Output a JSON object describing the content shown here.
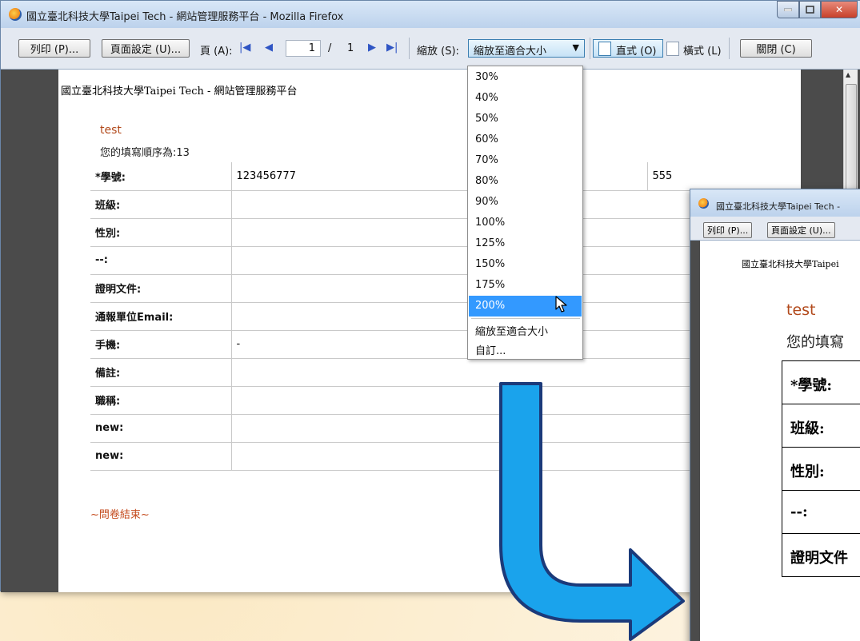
{
  "window": {
    "title": "國立臺北科技大學Taipei Tech - 網站管理服務平台 - Mozilla Firefox",
    "min_icon": "minimize-icon",
    "max_icon": "maximize-icon",
    "close_icon": "close-icon"
  },
  "toolbar": {
    "print_label": "列印 (P)...",
    "page_setup_label": "頁面設定 (U)...",
    "page_label": "頁 (A):",
    "current_page": "1",
    "page_separator": "/",
    "total_pages": "1",
    "zoom_label": "縮放 (S):",
    "zoom_value": "縮放至適合大小",
    "portrait_label": "直式 (O)",
    "landscape_label": "橫式 (L)",
    "close_label": "關閉 (C)"
  },
  "zoom_options": [
    "30%",
    "40%",
    "50%",
    "60%",
    "70%",
    "80%",
    "90%",
    "100%",
    "125%",
    "150%",
    "175%",
    "200%"
  ],
  "zoom_selected": "200%",
  "zoom_extra": [
    "縮放至適合大小",
    "自訂..."
  ],
  "page": {
    "header": "國立臺北科技大學Taipei Tech - 網站管理服務平台",
    "survey_title": "test",
    "order_text": "您的填寫順序為:13",
    "rows": [
      {
        "label": "*學號:",
        "value": "123456777",
        "extra": "555"
      },
      {
        "label": "班級:",
        "value": ""
      },
      {
        "label": "性別:",
        "value": ""
      },
      {
        "label": "--:",
        "value": ""
      },
      {
        "label": "證明文件:",
        "value": ""
      },
      {
        "label": "通報單位Email:",
        "value": ""
      },
      {
        "label": "手機:",
        "value": "-"
      },
      {
        "label": "備註:",
        "value": ""
      },
      {
        "label": "職稱:",
        "value": ""
      },
      {
        "label": "new:",
        "value": ""
      },
      {
        "label": "new:",
        "value": ""
      }
    ],
    "end_text": "~問卷結束~"
  },
  "preview": {
    "title": "國立臺北科技大學Taipei Tech -",
    "print_label": "列印 (P)...",
    "page_setup_label": "頁面設定 (U)...",
    "header": "國立臺北科技大學Taipei",
    "survey_title": "test",
    "order_text": "您的填寫",
    "rows": [
      "*學號:",
      "班級:",
      "性別:",
      "--:",
      "證明文件"
    ]
  },
  "colors": {
    "accent": "#3399ff",
    "survey_title": "#b24a1c",
    "arrow": "#1aa3ec"
  }
}
